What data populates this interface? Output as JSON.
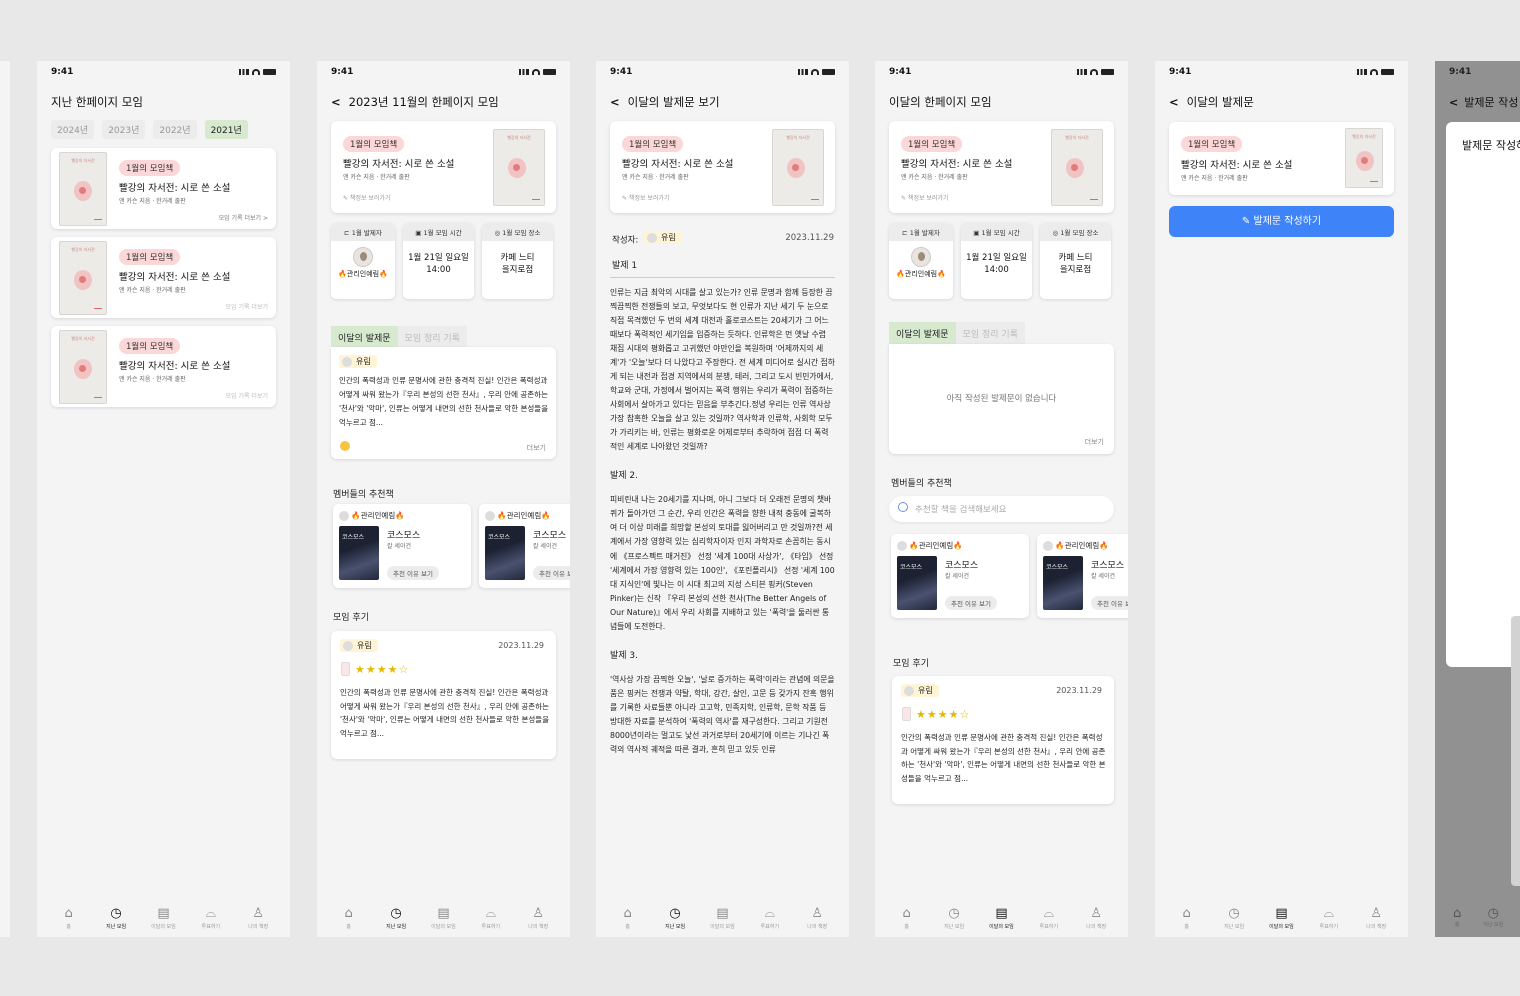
{
  "status_time": "9:41",
  "nav": {
    "home": "홈",
    "past": "지난 모임",
    "month": "이달의 모임",
    "vote": "투표하기",
    "mybook": "나의 책장"
  },
  "book": {
    "badge": "1월의 모임책",
    "title": "빨강의 자서전: 시로 쓴 소설",
    "meta": "앤 카슨 지음 · 한거레 출판",
    "info_link": "✎ 책정보 보러가기",
    "cover_text": "빨강의 자서전"
  },
  "screen1": {
    "title": "지난 한페이지 모임",
    "years": [
      "2024년",
      "2023년",
      "2022년",
      "2021년"
    ],
    "view_record": "모임 기록 더보기 >",
    "view_record_b": "모임 기록 더보기"
  },
  "screen2": {
    "title": "2023년 11월의 한페이지 모임",
    "presenter_head": "1월 발제자",
    "time_head": "1월 모임 시간",
    "place_head": "1월 모임 장소",
    "presenter_name": "🔥관리인예림🔥",
    "time_value": "1월 21일 일요일 14:00",
    "time_line1": "1월 21일 일요일",
    "time_line2": "14:00",
    "place_line1": "카페 느티",
    "place_line2": "을지로점",
    "tab_presentation": "이달의 발제문",
    "tab_record": "모임 정리 기록",
    "author": "유림",
    "excerpt": "인간의 폭력성과 인류 문명사에 관한 충격적 진실! 인간은 폭력성과 어떻게 싸워 왔는가『우리 본성의 선한 천사』, 우리 안에 공존하는 '천사'와 '악마', 인류는 어떻게 내면의 선한 천사들로 악한 본성들을 억누르고 점...",
    "more": "더보기",
    "members_rec": "멤버들의 추천책",
    "rec_user": "🔥관리인예림🔥",
    "rec_title": "코스모스",
    "rec_author": "칼 세이건",
    "rec_btn": "추천 이유 보기",
    "rec_cover": "코스모스",
    "review_title": "모임 후기",
    "review_date": "2023.11.29",
    "review_stars": "★★★★☆",
    "review_text": "인간의 폭력성과 인류 문명사에 관한 충격적 진실! 인간은 폭력성과 어떻게 싸워 왔는가『우리 본성의 선한 천사』, 우리 안에 공존하는 '천사'와 '악마', 인류는 어떻게 내면의 선한 천사들로 악한 본성들을 억누르고 점..."
  },
  "screen3": {
    "title": "이달의 발제문 보기",
    "writer_label": "작성자:",
    "writer": "유림",
    "date": "2023.11.29",
    "q1": "발제 1",
    "p1": "인류는 지금 최악의 시대를 살고 있는가? 인류 문명과 함께 등장한 끔찍끔찍한 전쟁들의 보고, 무엇보다도 현 인류가 지난 세기 두 눈으로 직접 목격했던 두 번의 세계 대전과 홀로코스트는 20세기가 그 어느 때보다 폭력적인 세기임을 입증하는 듯하다. 인류학은 먼 옛날 수렵 채집 시대의 평화롭고 고귀했던 야만인을 복원하며 '어제까지의 세계'가 '오늘'보다 더 나았다고 주장한다. 전 세계 미디어로 실시간 접하게 되는 내전과 접경 지역에서의 분쟁, 테러, 그리고 도시 빈민가에서, 학교와 군대, 가정에서 벌어지는 폭력 행위는 우리가 폭력이 점증하는 사회에서 살아가고 있다는 믿음을 부추긴다.정녕 우리는 인류 역사상 가장 참혹한 오늘을 살고 있는 것일까? 역사학과 인류학, 사회학 모두가 가리키는 바, 인류는 평화로운 어제로부터 추락하여 점점 더 폭력적인 세계로 나아왔던 것일까?",
    "q2": "발제 2.",
    "p2": "피비린내 나는 20세기를 지나며, 아니 그보다 더 오래전 문명의 챗바퀴가 돌아가던 그 순간, 우리 인간은 폭력을 향한 내적 충동에 굴복하여 더 이상 미래를 희망할 본성의 토대를 잃어버리고 만 것일까?전 세계에서 가장 영향력 있는 심리학자이자 인지 과학자로 손꼽히는 동시에 《프로스펙트 매거진》 선정 '세계 100대 사상가', 《타임》 선정 '세계에서 가장 영향력 있는 100인', 《포린폴리시》 선정 '세계 100대 지식인'에 빛나는 이 시대 최고의 지성 스티븐 핑커(Steven Pinker)는 신작 『우리 본성의 선한 천사(The Better Angels of Our Nature)』에서 우리 사회를 지배하고 있는 '폭력'을 둘러싼 통념들에 도전한다.",
    "q3": "발제 3.",
    "p3": "'역사상 가장 끔찍한 오늘', '날로 증가하는 폭력'이라는 관념에 의문을 품은 핑커는 전쟁과 약탈, 학대, 강간, 살인, 고문 등 갖가지 잔혹 행위를 기록한 사료들뿐 아니라 고고학, 민족지학, 인류학, 문학 작품 등 방대한 자료를 분석하여 '폭력의 역사'를 재구성한다. 그리고 기원전 8000년이라는 멀고도 낯선 과거로부터 20세기에 이르는 기나긴 폭력의 역사적 궤적을 따른 결과, 흔히 믿고 있듯 인류"
  },
  "screen4": {
    "title": "이달의 한페이지 모임",
    "empty": "아직 작성된 발제문이 없습니다",
    "search_placeholder": "추천할 책을 검색해보세요"
  },
  "screen5": {
    "title": "이달의 발제문",
    "write_btn": "발제문 작성하기"
  },
  "screen6": {
    "title": "발제문 작성",
    "panel_title": "발제문 작성하"
  }
}
